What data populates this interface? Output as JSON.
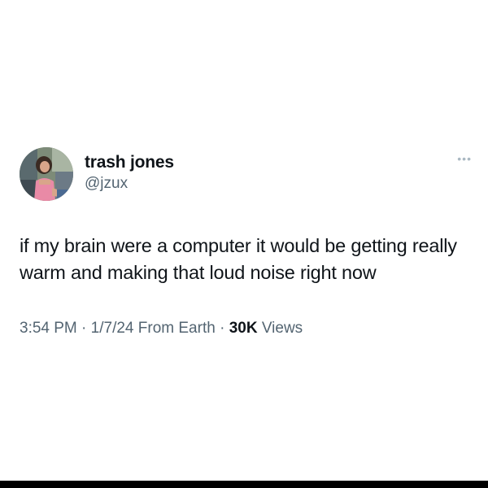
{
  "tweet": {
    "display_name": "trash jones",
    "handle": "@jzux",
    "more_icon": "more-horizontal-icon",
    "text": "if my brain were a computer it would be getting really warm and making that loud noise right now",
    "time": "3:54 PM",
    "date": "1/7/24",
    "source": "From Earth",
    "views_count": "30K",
    "views_label": "Views",
    "separator": "·"
  }
}
